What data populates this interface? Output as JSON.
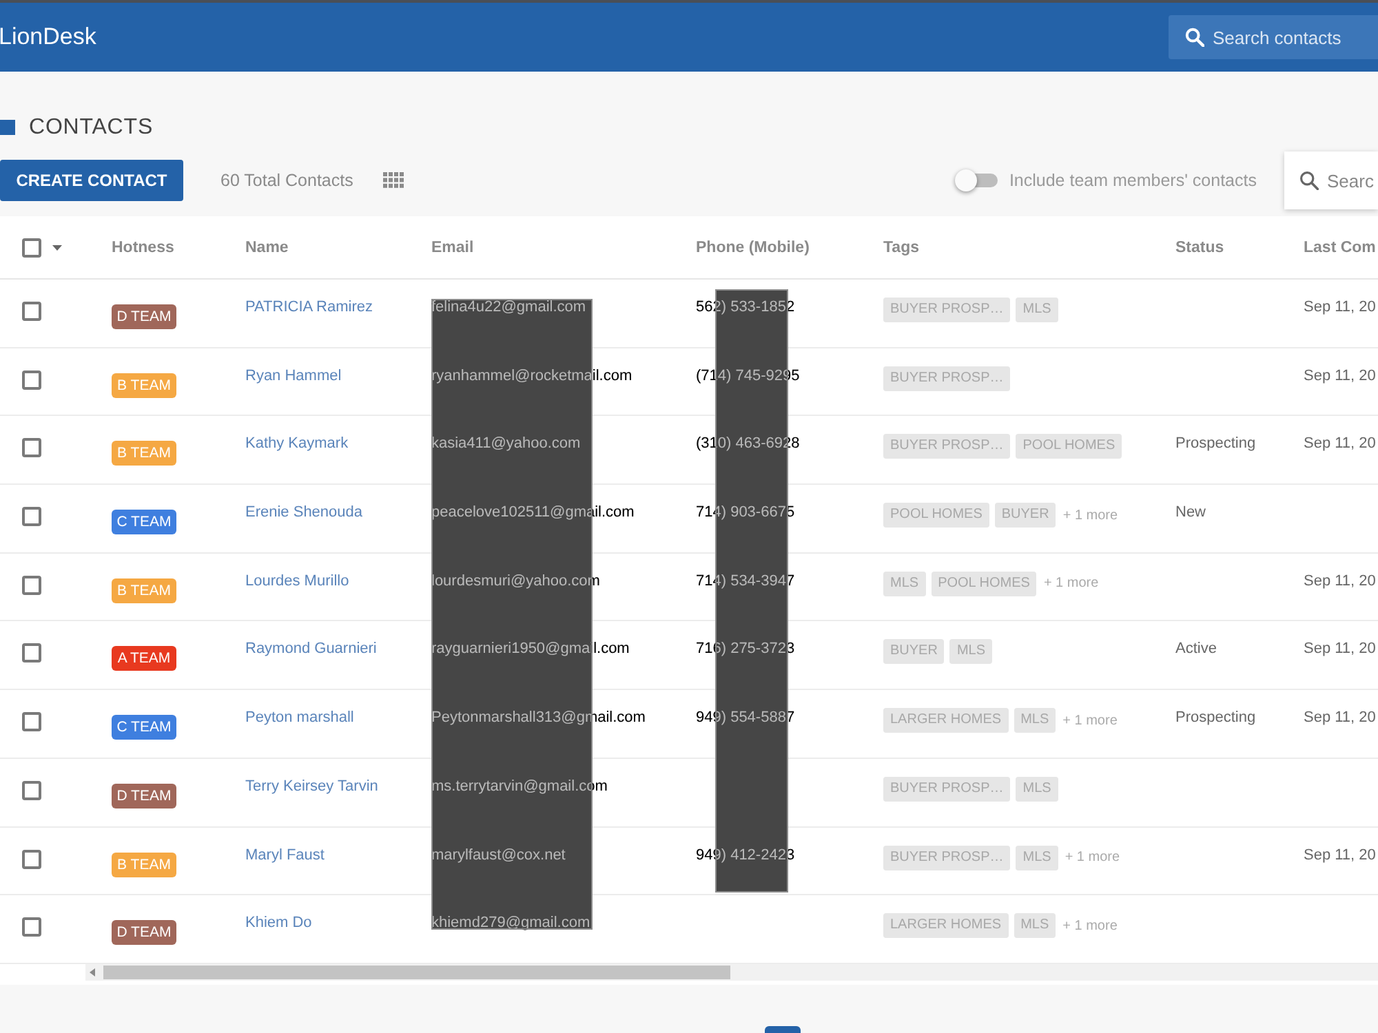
{
  "app_bar": {
    "brand": "LionDesk",
    "search": {
      "placeholder": "Search contacts"
    }
  },
  "page": {
    "title": "CONTACTS"
  },
  "toolbar": {
    "create_button": "CREATE CONTACT",
    "total": "60 Total Contacts",
    "team_toggle": {
      "label": "Include team members' contacts",
      "on": false
    },
    "search": {
      "placeholder": "Searc"
    }
  },
  "table": {
    "select_all": {
      "checked": false
    },
    "columns": [
      "Hotness",
      "Name",
      "Email",
      "Phone (Mobile)",
      "Tags",
      "Status",
      "Last Com"
    ],
    "rows": [
      {
        "checked": false,
        "hotness": {
          "label": "D TEAM",
          "color": "#a0675a"
        },
        "name": "PATRICIA Ramirez",
        "email": "felina4u22@gmail.com",
        "phone": "562) 533-1852",
        "tags": [
          "BUYER PROSP…",
          "MLS"
        ],
        "column_8": "Sep 11, 20"
      },
      {
        "checked": false,
        "hotness": {
          "label": "B TEAM",
          "color": "#f5a843"
        },
        "name": "Ryan Hammel",
        "email": "ryanhammel@rocketmail.com",
        "phone": "(714) 745-9295",
        "tags": [
          "BUYER PROSP…"
        ],
        "column_8": "Sep 11, 20"
      },
      {
        "checked": false,
        "hotness": {
          "label": "B TEAM",
          "color": "#f5a843"
        },
        "name": "Kathy Kaymark",
        "email": "kasia411@yahoo.com",
        "phone": "(310) 463-6928",
        "tags": [
          "BUYER PROSP…",
          "POOL HOMES"
        ],
        "status": "Prospecting",
        "column_8": "Sep 11, 20"
      },
      {
        "checked": false,
        "hotness": {
          "label": "C TEAM",
          "color": "#3f7fdf"
        },
        "name": "Erenie Shenouda",
        "email": "peacelove102511@gmail.com",
        "phone": "714) 903-6675",
        "tags": [
          "POOL HOMES",
          "BUYER"
        ],
        "more": "+ 1 more",
        "status": "New"
      },
      {
        "checked": false,
        "hotness": {
          "label": "B TEAM",
          "color": "#f5a843"
        },
        "name": "Lourdes Murillo",
        "email": "lourdesmuri@yahoo.com",
        "phone": "714) 534-3947",
        "tags": [
          "MLS",
          "POOL HOMES"
        ],
        "more": "+ 1 more",
        "column_8": "Sep 11, 20"
      },
      {
        "checked": false,
        "hotness": {
          "label": "A TEAM",
          "color": "#e8391f"
        },
        "name": "Raymond Guarnieri",
        "email": "rayguarnieri1950@gmail.com",
        "phone": "716) 275-3723",
        "tags": [
          "BUYER",
          "MLS"
        ],
        "status": "Active",
        "column_8": "Sep 11, 20"
      },
      {
        "checked": false,
        "hotness": {
          "label": "C TEAM",
          "color": "#3f7fdf"
        },
        "name": "Peyton marshall",
        "email": "Peytonmarshall313@gmail.com",
        "phone": "949) 554-5887",
        "tags": [
          "LARGER HOMES",
          "MLS"
        ],
        "more": "+ 1 more",
        "status": "Prospecting",
        "column_8": "Sep 11, 20"
      },
      {
        "checked": false,
        "hotness": {
          "label": "D TEAM",
          "color": "#a0675a"
        },
        "name": "Terry Keirsey Tarvin",
        "email": "ms.terrytarvin@gmail.com",
        "tags": [
          "BUYER PROSP…",
          "MLS"
        ]
      },
      {
        "checked": false,
        "hotness": {
          "label": "B TEAM",
          "color": "#f5a843"
        },
        "name": "Maryl Faust",
        "email": "marylfaust@cox.net",
        "phone": "949) 412-2423",
        "tags": [
          "BUYER PROSP…",
          "MLS"
        ],
        "more": "+ 1 more",
        "column_8": "Sep 11, 20"
      },
      {
        "checked": false,
        "hotness": {
          "label": "D TEAM",
          "color": "#a0675a"
        },
        "name": "Khiem Do",
        "email": "khiemd279@gmail.com",
        "tags": [
          "LARGER HOMES",
          "MLS"
        ],
        "more": "+ 1 more"
      }
    ]
  }
}
